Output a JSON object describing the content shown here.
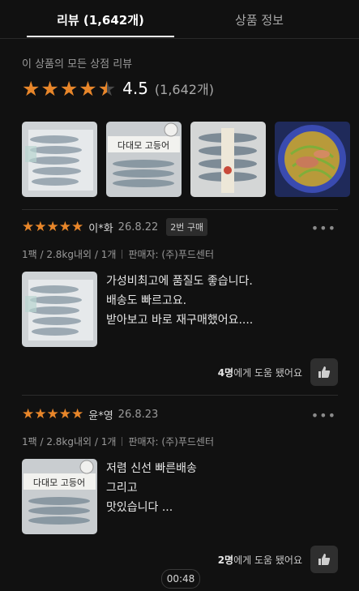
{
  "tabs": [
    {
      "label": "리뷰 (1,642개)",
      "active": true
    },
    {
      "label": "상품 정보",
      "active": false
    }
  ],
  "summary": {
    "label": "이 상품의 모든 상점 리뷰",
    "score": "4.5",
    "count": "(1,642개)",
    "stars_filled": 4.5,
    "star_color": "#e8862a"
  },
  "thumbnails": [
    {
      "name": "fish-pack-photo-1",
      "label": ""
    },
    {
      "name": "fish-pack-photo-2",
      "label": "다대모 고등어"
    },
    {
      "name": "fish-pack-photo-3",
      "label": ""
    },
    {
      "name": "cooked-dish-photo",
      "label": ""
    }
  ],
  "reviews": [
    {
      "stars": 5,
      "reviewer": "이*화",
      "date": "26.8.22",
      "badge": "2번 구매",
      "option": "1팩 / 2.8kg내외 / 1개",
      "seller": "판매자: (주)푸드센터",
      "lines": [
        "가성비최고에 품질도 좋습니다.",
        "배송도 빠르고요.",
        "받아보고 바로 재구매했어요...."
      ],
      "helpful_count": "4명",
      "helpful_suffix": "에게 도움 됐어요"
    },
    {
      "stars": 5,
      "reviewer": "윤*영",
      "date": "26.8.23",
      "badge": "",
      "option": "1팩 / 2.8kg내외 / 1개",
      "seller": "판매자: (주)푸드센터",
      "lines": [
        "저렴 신선 빠른배송",
        "그리고",
        "맛있습니다 ..."
      ],
      "helpful_count": "2명",
      "helpful_suffix": "에게 도움 됐어요"
    }
  ],
  "timer": "00:48",
  "icons": {
    "star": "star-icon",
    "more": "more-dots-icon",
    "like": "thumbs-up-icon"
  }
}
